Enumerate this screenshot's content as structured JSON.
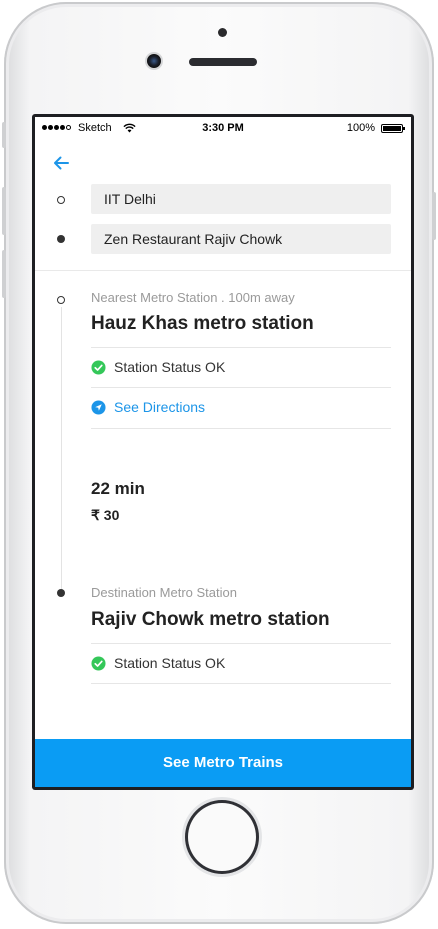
{
  "status_bar": {
    "carrier": "Sketch",
    "time": "3:30 PM",
    "battery": "100%",
    "battery_level": 1.0
  },
  "route": {
    "origin": "IIT Delhi",
    "destination": "Zen Restaurant Rajiv Chowk"
  },
  "nearest": {
    "caption": "Nearest Metro Station . 100m away",
    "station": "Hauz Khas metro station",
    "status": "Station Status OK",
    "directions": "See Directions"
  },
  "trip": {
    "duration": "22 min",
    "fare": "₹ 30"
  },
  "destination_station": {
    "caption": "Destination Metro Station",
    "station": "Rajiv Chowk metro station",
    "status": "Station Status OK"
  },
  "cta": {
    "label": "See Metro Trains"
  },
  "colors": {
    "accent": "#0a9cf4",
    "status_ok": "#34c759",
    "link": "#1c95e8"
  }
}
